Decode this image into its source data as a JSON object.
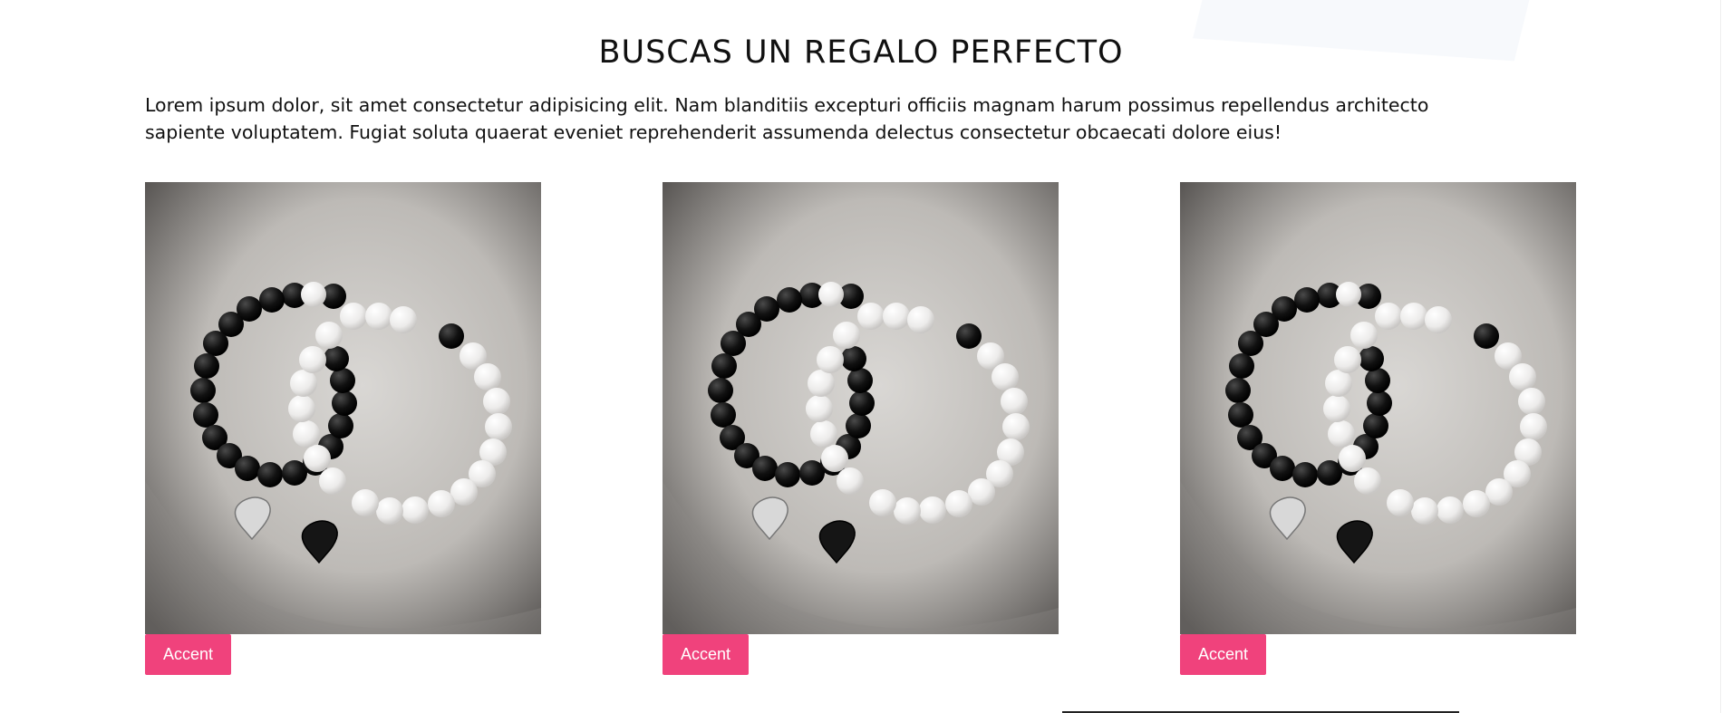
{
  "section": {
    "title": "BUSCAS UN REGALO PERFECTO",
    "intro": "Lorem ipsum dolor, sit amet consectetur adipisicing elit. Nam blanditiis excepturi officiis magnam harum possimus repellendus architecto sapiente voluptatem. Fugiat soluta quaerat eveniet reprehenderit assumenda delectus consectetur obcaecati dolore eius!"
  },
  "products": [
    {
      "button_label": "Accent",
      "image": "bracelet-pair-image"
    },
    {
      "button_label": "Accent",
      "image": "bracelet-pair-image"
    },
    {
      "button_label": "Accent",
      "image": "bracelet-pair-image"
    }
  ],
  "colors": {
    "accent": "#f0427c",
    "text": "#111111",
    "background": "#ffffff"
  }
}
